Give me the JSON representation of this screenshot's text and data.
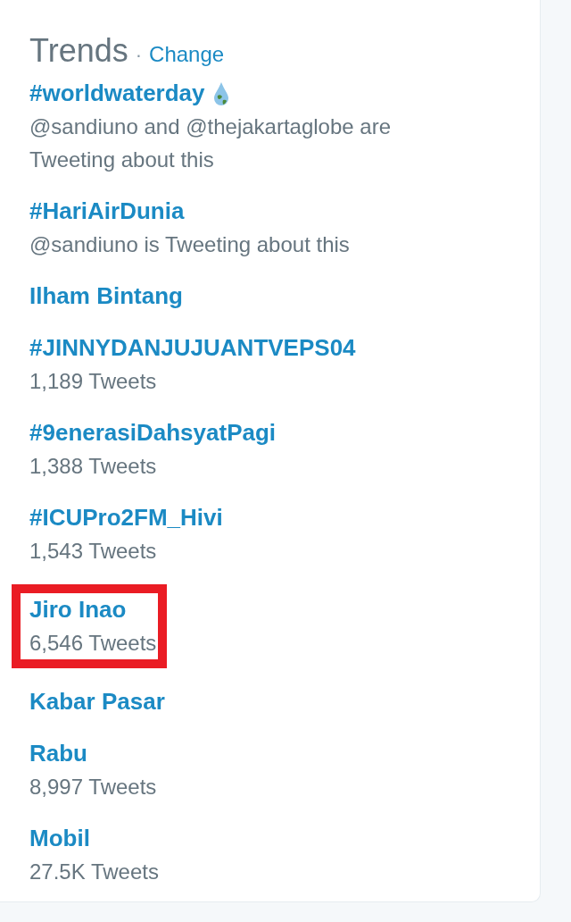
{
  "header": {
    "title": "Trends",
    "separator": "·",
    "link": "Change"
  },
  "trends": [
    {
      "name": "#worldwaterday",
      "icon": true,
      "context": "@sandiuno and @thejakartaglobe are Tweeting about this",
      "highlighted": false
    },
    {
      "name": "#HariAirDunia",
      "context": "@sandiuno is Tweeting about this",
      "highlighted": false
    },
    {
      "name": "Ilham Bintang",
      "highlighted": false
    },
    {
      "name": "#JINNYDANJUJUANTVEPS04",
      "context": "1,189 Tweets",
      "highlighted": false
    },
    {
      "name": "#9enerasiDahsyatPagi",
      "context": "1,388 Tweets",
      "highlighted": false
    },
    {
      "name": "#ICUPro2FM_Hivi",
      "context": "1,543 Tweets",
      "highlighted": false
    },
    {
      "name": "Jiro Inao",
      "context": "6,546 Tweets",
      "highlighted": true
    },
    {
      "name": "Kabar Pasar",
      "highlighted": false
    },
    {
      "name": "Rabu",
      "context": "8,997 Tweets",
      "highlighted": false
    },
    {
      "name": "Mobil",
      "context": "27.5K Tweets",
      "highlighted": false
    }
  ]
}
